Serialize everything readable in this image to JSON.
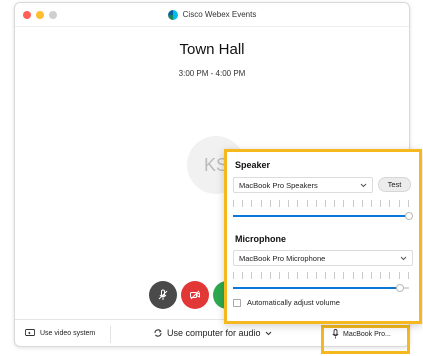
{
  "window": {
    "title": "Cisco Webex Events"
  },
  "meeting": {
    "title": "Town Hall",
    "time": "3:00 PM - 4:00 PM",
    "avatar_initials": "KS"
  },
  "controls": [
    {
      "name": "mute-button",
      "icon": "microphone-muted-icon"
    },
    {
      "name": "video-button",
      "icon": "video-off-icon"
    },
    {
      "name": "join-button",
      "icon": "join-icon"
    }
  ],
  "bottom_bar": {
    "video_system_label": "Use video system",
    "audio_label": "Use computer for audio",
    "speaker_label": "MacBook Pro..."
  },
  "audio_popover": {
    "speaker": {
      "title": "Speaker",
      "selected": "MacBook Pro Speakers",
      "test_label": "Test",
      "volume": 1.0
    },
    "microphone": {
      "title": "Microphone",
      "selected": "MacBook Pro Microphone",
      "volume": 0.95
    },
    "auto_adjust_label": "Automatically adjust volume",
    "auto_adjust_checked": false
  },
  "colors": {
    "highlight": "#f5b81e",
    "mute": "#4a4a4a",
    "video": "#e13737",
    "join": "#2fa84f",
    "slider": "#0a78d7"
  }
}
